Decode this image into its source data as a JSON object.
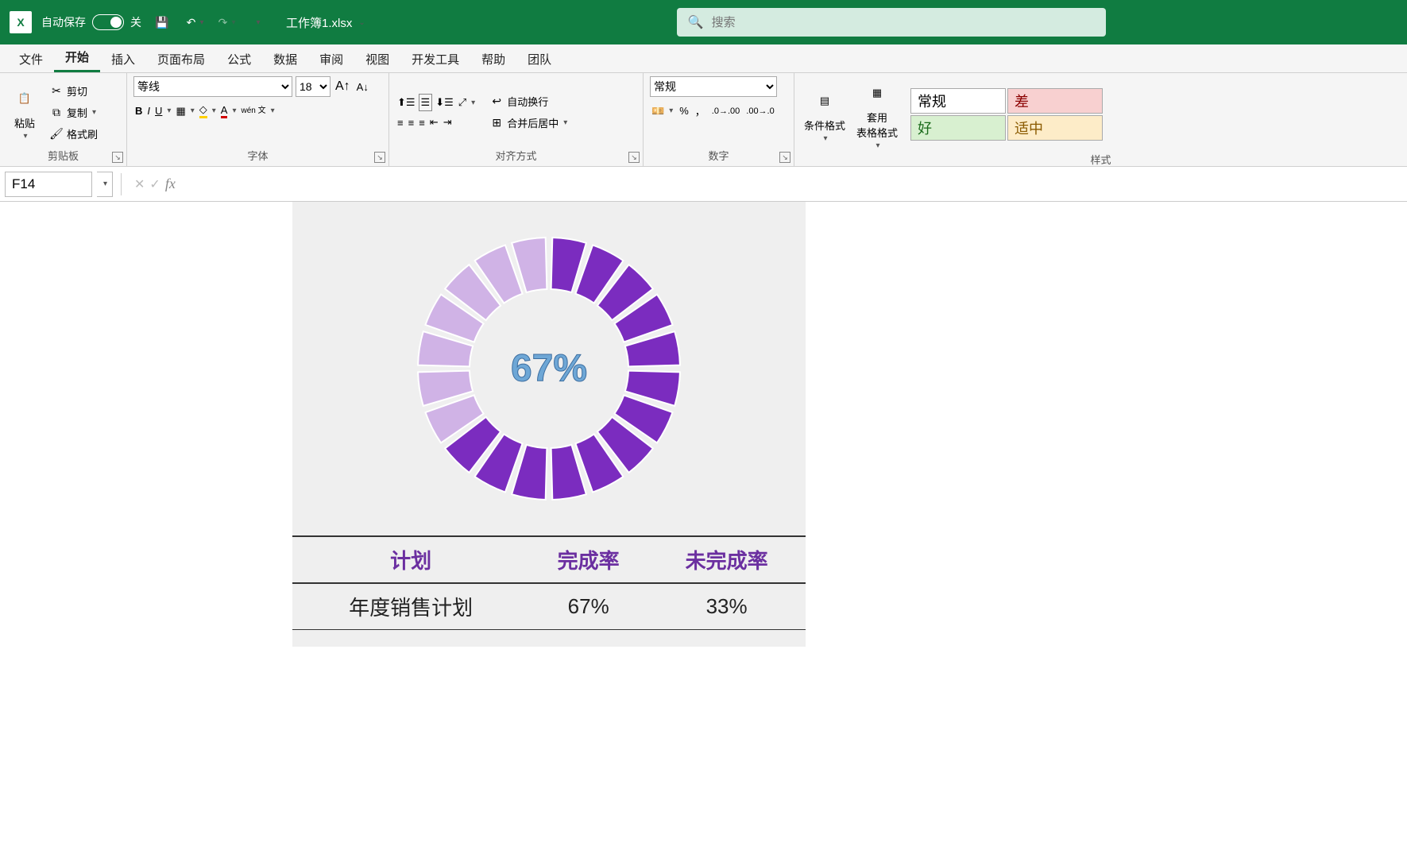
{
  "title_bar": {
    "autosave_label": "自动保存",
    "autosave_state": "关",
    "file_name": "工作簿1.xlsx",
    "search_placeholder": "搜索"
  },
  "tabs": [
    "文件",
    "开始",
    "插入",
    "页面布局",
    "公式",
    "数据",
    "审阅",
    "视图",
    "开发工具",
    "帮助",
    "团队"
  ],
  "active_tab": "开始",
  "ribbon": {
    "clipboard": {
      "paste": "粘贴",
      "cut": "剪切",
      "copy": "复制",
      "format_painter": "格式刷",
      "group_label": "剪贴板"
    },
    "font": {
      "font_name": "等线",
      "font_size": "18",
      "phonetic": "wén 文",
      "group_label": "字体"
    },
    "alignment": {
      "wrap_text": "自动换行",
      "merge_center": "合并后居中",
      "group_label": "对齐方式"
    },
    "number": {
      "format": "常规",
      "group_label": "数字"
    },
    "styles": {
      "conditional": "条件格式",
      "format_table": "套用\n表格格式",
      "cell_normal": "常规",
      "cell_bad": "差",
      "cell_good": "好",
      "cell_neutral": "适中",
      "group_label": "样式"
    }
  },
  "formula_bar": {
    "cell_ref": "F14",
    "formula": ""
  },
  "chart_data": {
    "type": "pie",
    "segments": 20,
    "completed_fraction": 0.67,
    "center_label": "67%",
    "colors": {
      "done": "#7b2cbf",
      "remaining": "#d0b3e6",
      "gap": "#ffffff"
    }
  },
  "data_table": {
    "headers": [
      "计划",
      "完成率",
      "未完成率"
    ],
    "row": [
      "年度销售计划",
      "67%",
      "33%"
    ]
  }
}
